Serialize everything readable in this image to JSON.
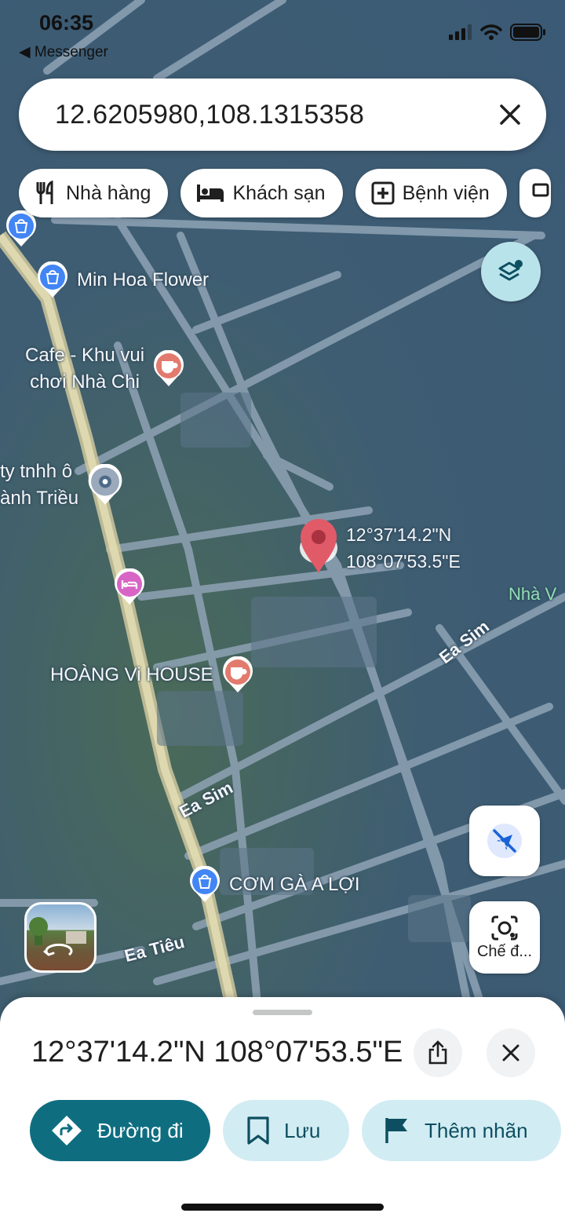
{
  "status_bar": {
    "time": "06:35",
    "back_label": "◀ Messenger"
  },
  "search": {
    "query": "12.6205980,108.1315358"
  },
  "chips": [
    {
      "label": "Nhà hàng",
      "icon": "fork-knife-icon"
    },
    {
      "label": "Khách sạn",
      "icon": "bed-icon"
    },
    {
      "label": "Bệnh viện",
      "icon": "hospital-icon"
    }
  ],
  "map": {
    "pois": [
      {
        "label": "Min Hoa Flower",
        "icon": "shopping-bag-icon",
        "color": "#4285f4"
      },
      {
        "label": "Cafe - Khu vui\nchơi Nhà Chi",
        "icon": "coffee-icon",
        "color": "#e27a6e"
      },
      {
        "label": "ty tnhh ô\nành Triều",
        "icon": "place-icon",
        "color": "#7c8fa6"
      },
      {
        "label": "HOÀNG Vi HOUSE",
        "icon": "coffee-icon",
        "color": "#e27a6e"
      },
      {
        "label": "CƠM GÀ A LỢI",
        "icon": "shopping-bag-icon",
        "color": "#4285f4"
      }
    ],
    "road_labels": [
      "Ea Sim",
      "Ea Sim",
      "Ea Tiêu",
      "Nhà V"
    ],
    "marker_coords": "12°37'14.2\"N\n108°07'53.5\"E",
    "marker_color": "#e15a68"
  },
  "floating": {
    "lens_label": "Chế đ..."
  },
  "sheet": {
    "title": "12°37'14.2\"N 108°07'53.5\"E",
    "directions_label": "Đường đi",
    "save_label": "Lưu",
    "label_label": "Thêm nhãn",
    "accent": "#0e6e80"
  }
}
